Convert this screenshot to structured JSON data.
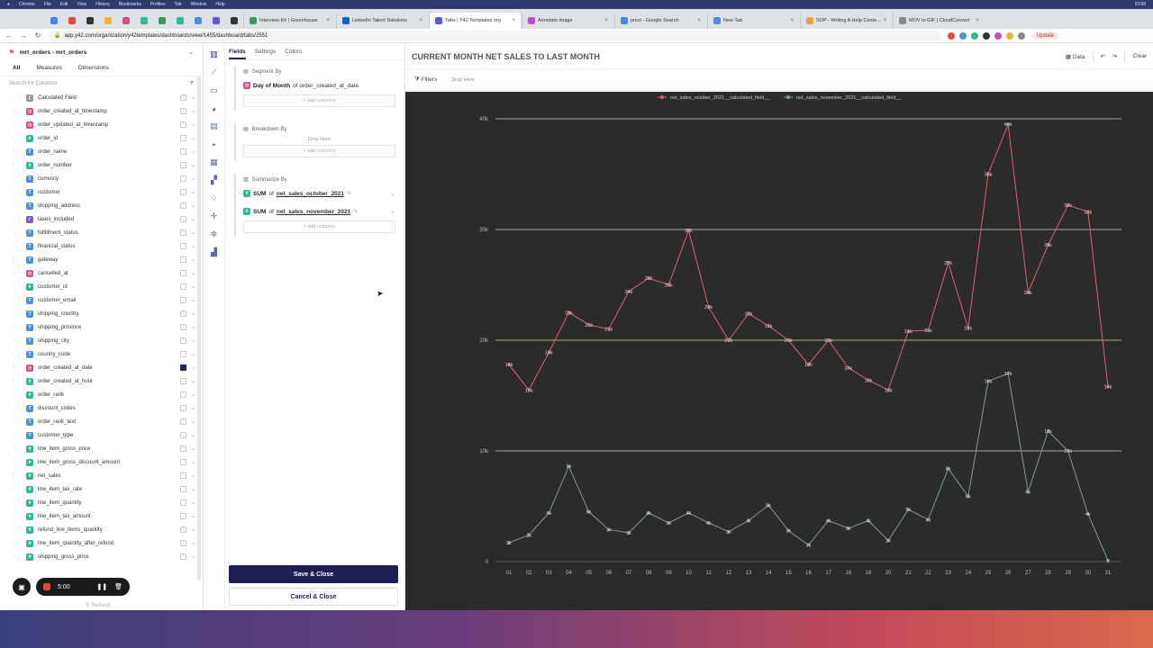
{
  "menubar": {
    "items": [
      "Chrome",
      "File",
      "Edit",
      "View",
      "History",
      "Bookmarks",
      "Profiles",
      "Tab",
      "Window",
      "Help"
    ],
    "clock": "10:08"
  },
  "browser": {
    "tabs": [
      {
        "title": "Interview Kit | Greenhouse",
        "color": "#3a9a5b"
      },
      {
        "title": "LinkedIn Talent Solutions",
        "color": "#0a66c2"
      },
      {
        "title": "Tabs | Y42 Templates org",
        "color": "#5b5bd6",
        "active": true
      },
      {
        "title": "Annotate image",
        "color": "#c04fd8"
      },
      {
        "title": "prezi - Google Search",
        "color": "#4285f4"
      },
      {
        "title": "New Tab",
        "color": "#4a90e2"
      },
      {
        "title": "SOP - Writing A Help Cente...",
        "color": "#e8a33a"
      },
      {
        "title": "MOV to GIF | CloudConvert",
        "color": "#8a8a8a"
      }
    ],
    "url": "app.y42.com/organization/y42templates/dashboards/view/1455/dashboard/tabs/2551",
    "update_label": "Update"
  },
  "left": {
    "model": "mrt_orders - mrt_orders",
    "tabs": [
      "All",
      "Measures",
      "Dimensions"
    ],
    "search_placeholder": "Search for Columns",
    "fields": [
      {
        "name": "Calculated Field",
        "type": "calc",
        "t": "ƒ"
      },
      {
        "name": "order_created_at_timestamp",
        "type": "date",
        "t": "◷"
      },
      {
        "name": "order_updated_at_timestamp",
        "type": "date",
        "t": "◷"
      },
      {
        "name": "order_id",
        "type": "num",
        "t": "#"
      },
      {
        "name": "order_name",
        "type": "str",
        "t": "T"
      },
      {
        "name": "order_number",
        "type": "num",
        "t": "#"
      },
      {
        "name": "currency",
        "type": "str",
        "t": "T"
      },
      {
        "name": "customer",
        "type": "str",
        "t": "T"
      },
      {
        "name": "shipping_address",
        "type": "str",
        "t": "T"
      },
      {
        "name": "taxes_included",
        "type": "bool",
        "t": "✓"
      },
      {
        "name": "fulfillment_status",
        "type": "str",
        "t": "T"
      },
      {
        "name": "financial_status",
        "type": "str",
        "t": "T"
      },
      {
        "name": "gateway",
        "type": "str",
        "t": "T"
      },
      {
        "name": "cancelled_at",
        "type": "date",
        "t": "◷"
      },
      {
        "name": "customer_id",
        "type": "num",
        "t": "#"
      },
      {
        "name": "customer_email",
        "type": "str",
        "t": "T"
      },
      {
        "name": "shipping_country",
        "type": "str",
        "t": "T"
      },
      {
        "name": "shipping_province",
        "type": "str",
        "t": "T"
      },
      {
        "name": "shipping_city",
        "type": "str",
        "t": "T"
      },
      {
        "name": "country_code",
        "type": "str",
        "t": "T"
      },
      {
        "name": "order_created_at_date",
        "type": "date",
        "t": "◷",
        "checked": true
      },
      {
        "name": "order_created_at_hour",
        "type": "num",
        "t": "#"
      },
      {
        "name": "order_rank",
        "type": "num",
        "t": "#"
      },
      {
        "name": "discount_codes",
        "type": "str",
        "t": "T"
      },
      {
        "name": "order_rank_text",
        "type": "str",
        "t": "T"
      },
      {
        "name": "customer_type",
        "type": "str",
        "t": "T"
      },
      {
        "name": "line_item_gross_price",
        "type": "num",
        "t": "#"
      },
      {
        "name": "line_item_gross_discount_amount",
        "type": "num",
        "t": "#"
      },
      {
        "name": "net_sales",
        "type": "num",
        "t": "#"
      },
      {
        "name": "line_item_tax_rate",
        "type": "num",
        "t": "#"
      },
      {
        "name": "line_item_quantity",
        "type": "num",
        "t": "#"
      },
      {
        "name": "line_item_tax_amount",
        "type": "num",
        "t": "#"
      },
      {
        "name": "refund_line_items_quantity",
        "type": "num",
        "t": "#"
      },
      {
        "name": "line_item_quantity_after_refund",
        "type": "num",
        "t": "#"
      },
      {
        "name": "shipping_gross_price",
        "type": "num",
        "t": "#"
      }
    ],
    "refresh_label": "Refresh",
    "recorder_time": "5:00"
  },
  "config": {
    "tabs": [
      "Fields",
      "Settings",
      "Colors"
    ],
    "segment_title": "Segment By",
    "segment_field_bold": "Day of Month",
    "segment_field_rest": "of order_created_at_date",
    "add_columns": "+ add columns",
    "breakdown_title": "Breakdown By",
    "drop_here": "Drop Here",
    "summarize_title": "Summarize By",
    "agg": "SUM",
    "of": "of",
    "measure1": "net_sales_october_2021",
    "measure2": "net_sales_november_2021",
    "save_label": "Save & Close",
    "cancel_label": "Cancel & Close"
  },
  "main": {
    "title": "CURRENT MONTH NET SALES TO LAST MONTH",
    "data_label": "Data",
    "clear_label": "Clear",
    "filters_label": "Filters",
    "drop_here": "Drop Here"
  },
  "chart_data": {
    "type": "line",
    "categories": [
      "01",
      "02",
      "03",
      "04",
      "05",
      "06",
      "07",
      "08",
      "09",
      "10",
      "11",
      "12",
      "13",
      "14",
      "15",
      "16",
      "17",
      "18",
      "19",
      "20",
      "21",
      "22",
      "23",
      "24",
      "25",
      "26",
      "27",
      "28",
      "29",
      "30",
      "31"
    ],
    "yticks": [
      "0",
      "10k",
      "20k",
      "30k",
      "40k"
    ],
    "ylim": [
      0,
      40000
    ],
    "reference_line": 20000,
    "series": [
      {
        "name": "net_sales_october_2021__calculated_field__",
        "color": "#d9646b",
        "values": [
          17800,
          15500,
          18900,
          22500,
          21400,
          21000,
          24400,
          25600,
          25000,
          29900,
          23000,
          20000,
          22400,
          21300,
          20000,
          17800,
          20000,
          17500,
          16400,
          15500,
          20800,
          20900,
          27000,
          21100,
          35000,
          39500,
          24300,
          28600,
          32200,
          31600,
          15800
        ],
        "labels": [
          "18k",
          "15k",
          "19k",
          "23k",
          "21k",
          "21k",
          "24k",
          "26k",
          "25k",
          "30k",
          "23k",
          "20k",
          "22k",
          "21k",
          "20k",
          "18k",
          "20k",
          "17k",
          "16k",
          "15k",
          "21k",
          "21k",
          "27k",
          "21k",
          "35k",
          "40k",
          "24k",
          "29k",
          "32k",
          "32k",
          "16k"
        ]
      },
      {
        "name": "net_sales_november_2021__calculated_field__",
        "color": "#7b9e98",
        "values": [
          1700,
          2400,
          4400,
          8600,
          4500,
          2900,
          2600,
          4400,
          3500,
          4400,
          3500,
          2700,
          3700,
          5100,
          2800,
          1500,
          3700,
          3000,
          3700,
          1900,
          4700,
          3800,
          8400,
          5900,
          16300,
          17000,
          6300,
          11800,
          10000,
          4300,
          100
        ],
        "labels": [
          "2k",
          "2k",
          "4k",
          "9k",
          "5k",
          "3k",
          "3k",
          "4k",
          "3k",
          "4k",
          "4k",
          "3k",
          "4k",
          "5k",
          "3k",
          "2k",
          "4k",
          "3k",
          "4k",
          "2k",
          "5k",
          "4k",
          "8k",
          "6k",
          "16k",
          "17k",
          "6k",
          "12k",
          "10k",
          "4k",
          "0"
        ]
      }
    ],
    "legend_position": "top-center",
    "grid": true
  }
}
